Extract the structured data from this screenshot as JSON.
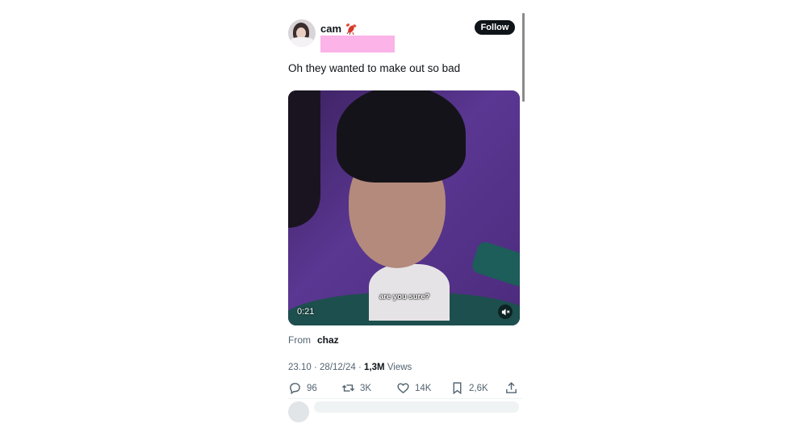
{
  "user": {
    "display_name": "cam",
    "emoji": "🦞"
  },
  "follow_label": "Follow",
  "tweet_text": "Oh they wanted to make out so bad",
  "video": {
    "caption": "are you sure?",
    "duration": "0:21"
  },
  "attribution": {
    "prefix": "From",
    "source": "chaz"
  },
  "meta": {
    "time": "23.10",
    "date": "28/12/24",
    "views_count": "1,3M",
    "views_label": "Views",
    "separator": "·"
  },
  "actions": {
    "replies": "96",
    "reposts": "3K",
    "likes": "14K",
    "bookmarks": "2,6K"
  },
  "icons": [
    "reply-icon",
    "repost-icon",
    "like-icon",
    "bookmark-icon",
    "share-icon",
    "mute-icon"
  ],
  "colors": {
    "follow_bg": "#0f1419",
    "redaction": "#fbb3e8",
    "muted_text": "#536471"
  }
}
